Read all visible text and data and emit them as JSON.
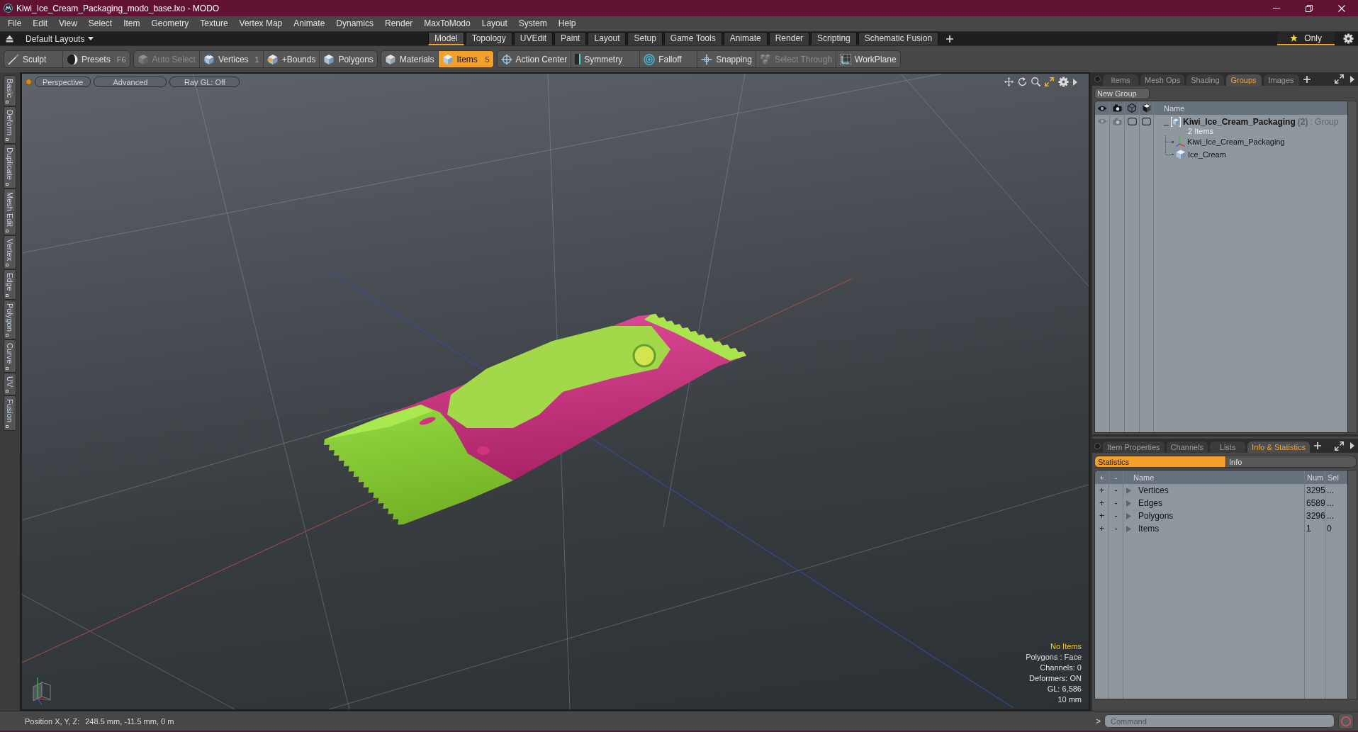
{
  "window": {
    "title": "Kiwi_Ice_Cream_Packaging_modo_base.lxo - MODO"
  },
  "menu": [
    "File",
    "Edit",
    "View",
    "Select",
    "Item",
    "Geometry",
    "Texture",
    "Vertex Map",
    "Animate",
    "Dynamics",
    "Render",
    "MaxToModo",
    "Layout",
    "System",
    "Help"
  ],
  "layout_bar": {
    "preset": "Default Layouts",
    "tabs": [
      {
        "label": "Model",
        "selected": true
      },
      {
        "label": "Topology",
        "selected": false
      },
      {
        "label": "UVEdit",
        "selected": false
      },
      {
        "label": "Paint",
        "selected": false
      },
      {
        "label": "Layout",
        "selected": false
      },
      {
        "label": "Setup",
        "selected": false
      },
      {
        "label": "Game Tools",
        "selected": false
      },
      {
        "label": "Animate",
        "selected": false
      },
      {
        "label": "Render",
        "selected": false
      },
      {
        "label": "Scripting",
        "selected": false
      },
      {
        "label": "Schematic Fusion",
        "selected": false
      }
    ],
    "only": {
      "label": "Only",
      "on": true
    }
  },
  "toolbar": {
    "groups": [
      {
        "buttons": [
          {
            "label": "Sculpt",
            "selected": false,
            "disabled": false
          },
          {
            "label": "Presets",
            "shortcut": "F6",
            "selected": false,
            "disabled": false
          }
        ]
      },
      {
        "buttons": [
          {
            "label": "Auto Select",
            "selected": false,
            "disabled": true
          },
          {
            "label": "Vertices",
            "shortcut": "1",
            "selected": false,
            "disabled": false
          },
          {
            "label": "+Bounds",
            "selected": false,
            "disabled": false
          },
          {
            "label": "Polygons",
            "selected": false,
            "disabled": false
          }
        ]
      },
      {
        "buttons": [
          {
            "label": "Materials",
            "selected": false,
            "disabled": false
          },
          {
            "label": "Items",
            "shortcut": "5",
            "selected": true,
            "disabled": false
          }
        ]
      },
      {
        "buttons": [
          {
            "label": "Action Center",
            "selected": false,
            "disabled": false
          },
          {
            "label": "Symmetry",
            "selected": false,
            "disabled": false
          },
          {
            "label": "Falloff",
            "selected": false,
            "disabled": false
          },
          {
            "label": "Snapping",
            "selected": false,
            "disabled": false
          },
          {
            "label": "Select Through",
            "selected": false,
            "disabled": true
          },
          {
            "label": "WorkPlane",
            "selected": false,
            "disabled": false
          }
        ]
      }
    ]
  },
  "side_tabs": [
    "Basic",
    "Deform",
    "Duplicate",
    "Mesh Edit",
    "Vertex",
    "Edge",
    "Polygon",
    "Curve",
    "UV",
    "Fusion"
  ],
  "viewport": {
    "header": [
      "Perspective",
      "Advanced",
      "Ray GL: Off"
    ],
    "selection_status": "No Items",
    "info": [
      "Polygons : Face",
      "Channels: 0",
      "Deformers: ON",
      "GL: 6,586",
      "10 mm"
    ]
  },
  "groups_panel": {
    "tabs": [
      {
        "label": "Items",
        "selected": false
      },
      {
        "label": "Mesh Ops",
        "selected": false
      },
      {
        "label": "Shading",
        "selected": false
      },
      {
        "label": "Groups",
        "selected": true
      },
      {
        "label": "Images",
        "selected": false
      }
    ],
    "new_group": "New Group",
    "name_column": "Name",
    "groups": [
      {
        "name": "Kiwi_Ice_Cream_Packaging",
        "count": "(2)",
        "type": ": Group",
        "summary": "2 Items",
        "expanded": true,
        "children": [
          {
            "name": "Kiwi_Ice_Cream_Packaging",
            "kind": "locator"
          },
          {
            "name": "Ice_Cream",
            "kind": "mesh"
          }
        ]
      }
    ]
  },
  "stats_panel": {
    "tabs": [
      {
        "label": "Item Properties",
        "selected": false
      },
      {
        "label": "Channels",
        "selected": false
      },
      {
        "label": "Lists",
        "selected": false
      },
      {
        "label": "Info & Statistics",
        "selected": true
      }
    ],
    "subtabs": [
      {
        "label": "Statistics",
        "selected": true
      },
      {
        "label": "Info",
        "selected": false
      }
    ],
    "columns": [
      "+",
      "-",
      "Name",
      "Num",
      "Sel"
    ],
    "rows": [
      {
        "add": "+",
        "remove": "-",
        "name": "Vertices",
        "num": "3295",
        "sel": "...",
        "expanded": false
      },
      {
        "add": "+",
        "remove": "-",
        "name": "Edges",
        "num": "6589",
        "sel": "...",
        "expanded": false
      },
      {
        "add": "+",
        "remove": "-",
        "name": "Polygons",
        "num": "3296",
        "sel": "...",
        "expanded": false
      },
      {
        "add": "+",
        "remove": "-",
        "name": "Items",
        "num": "1",
        "sel": "0",
        "expanded": false
      }
    ]
  },
  "status_bar": {
    "label": "Position X, Y, Z:",
    "value": "248.5 mm, -11.5 mm, 0 m"
  },
  "command": {
    "prompt": ">",
    "placeholder": "Command"
  }
}
